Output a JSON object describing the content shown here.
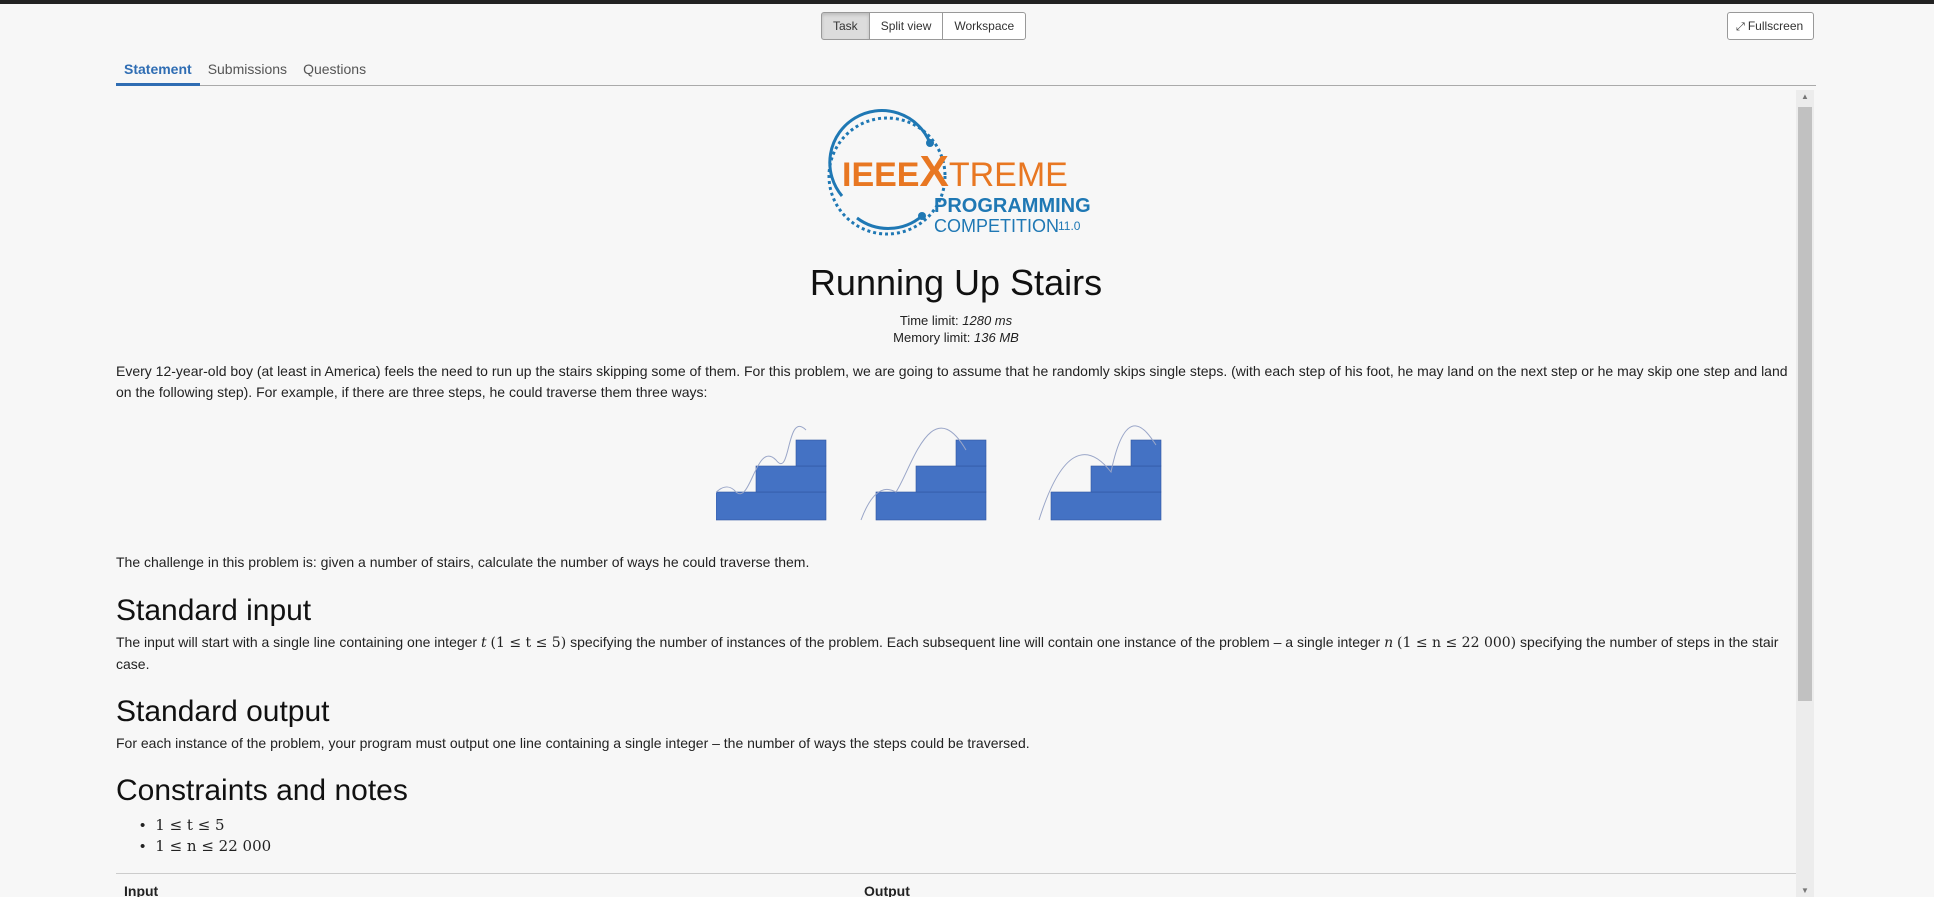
{
  "view_switch": {
    "task": "Task",
    "split": "Split view",
    "workspace": "Workspace"
  },
  "fullscreen": {
    "icon": "expand-arrows-icon",
    "label": "Fullscreen"
  },
  "tabs": [
    "Statement",
    "Submissions",
    "Questions"
  ],
  "logo": {
    "line1_a": "IEEE",
    "line1_b": "X",
    "line1_c": "TREME",
    "line2": "PROGRAMMING",
    "line3": "COMPETITION",
    "version": "11.0"
  },
  "problem": {
    "title": "Running Up Stairs",
    "time_label": "Time limit:",
    "time_value": "1280 ms",
    "memory_label": "Memory limit:",
    "memory_value": "136 MB",
    "intro": "Every 12-year-old boy (at least in America) feels the need to run up the stairs skipping some of them. For this problem, we are going to assume that he randomly skips single steps. (with each step of his foot, he may land on the next step or he may skip one step and land on the following step). For example, if there are three steps, he could traverse them three ways:",
    "challenge": "The challenge in this problem is: given a number of stairs, calculate the number of ways he could traverse them."
  },
  "sections": {
    "input_title": "Standard input",
    "input_text_a": "The input will start with a single line containing one integer",
    "input_text_b": "specifying the number of instances of the problem. Each subsequent line will contain one instance of the problem – a single integer",
    "input_text_c": "specifying the number of steps in the stair case.",
    "input_math_t": "t",
    "input_math_t_range": "(1 ≤ t ≤ 5)",
    "input_math_n": "n",
    "input_math_n_range": "(1 ≤ n ≤ 22 000)",
    "output_title": "Standard output",
    "output_text": "For each instance of the problem, your program must output one line containing a single integer – the number of ways the steps could be traversed.",
    "constraints_title": "Constraints and notes",
    "constraints": [
      "1 ≤ t ≤ 5",
      "1 ≤ n ≤ 22 000"
    ]
  },
  "io_table": {
    "input_header": "Input",
    "output_header": "Output"
  },
  "colors": {
    "accent": "#2f6db3",
    "stairs": "#4472c4",
    "logo_blue": "#1f78b4",
    "logo_orange": "#e87722"
  }
}
